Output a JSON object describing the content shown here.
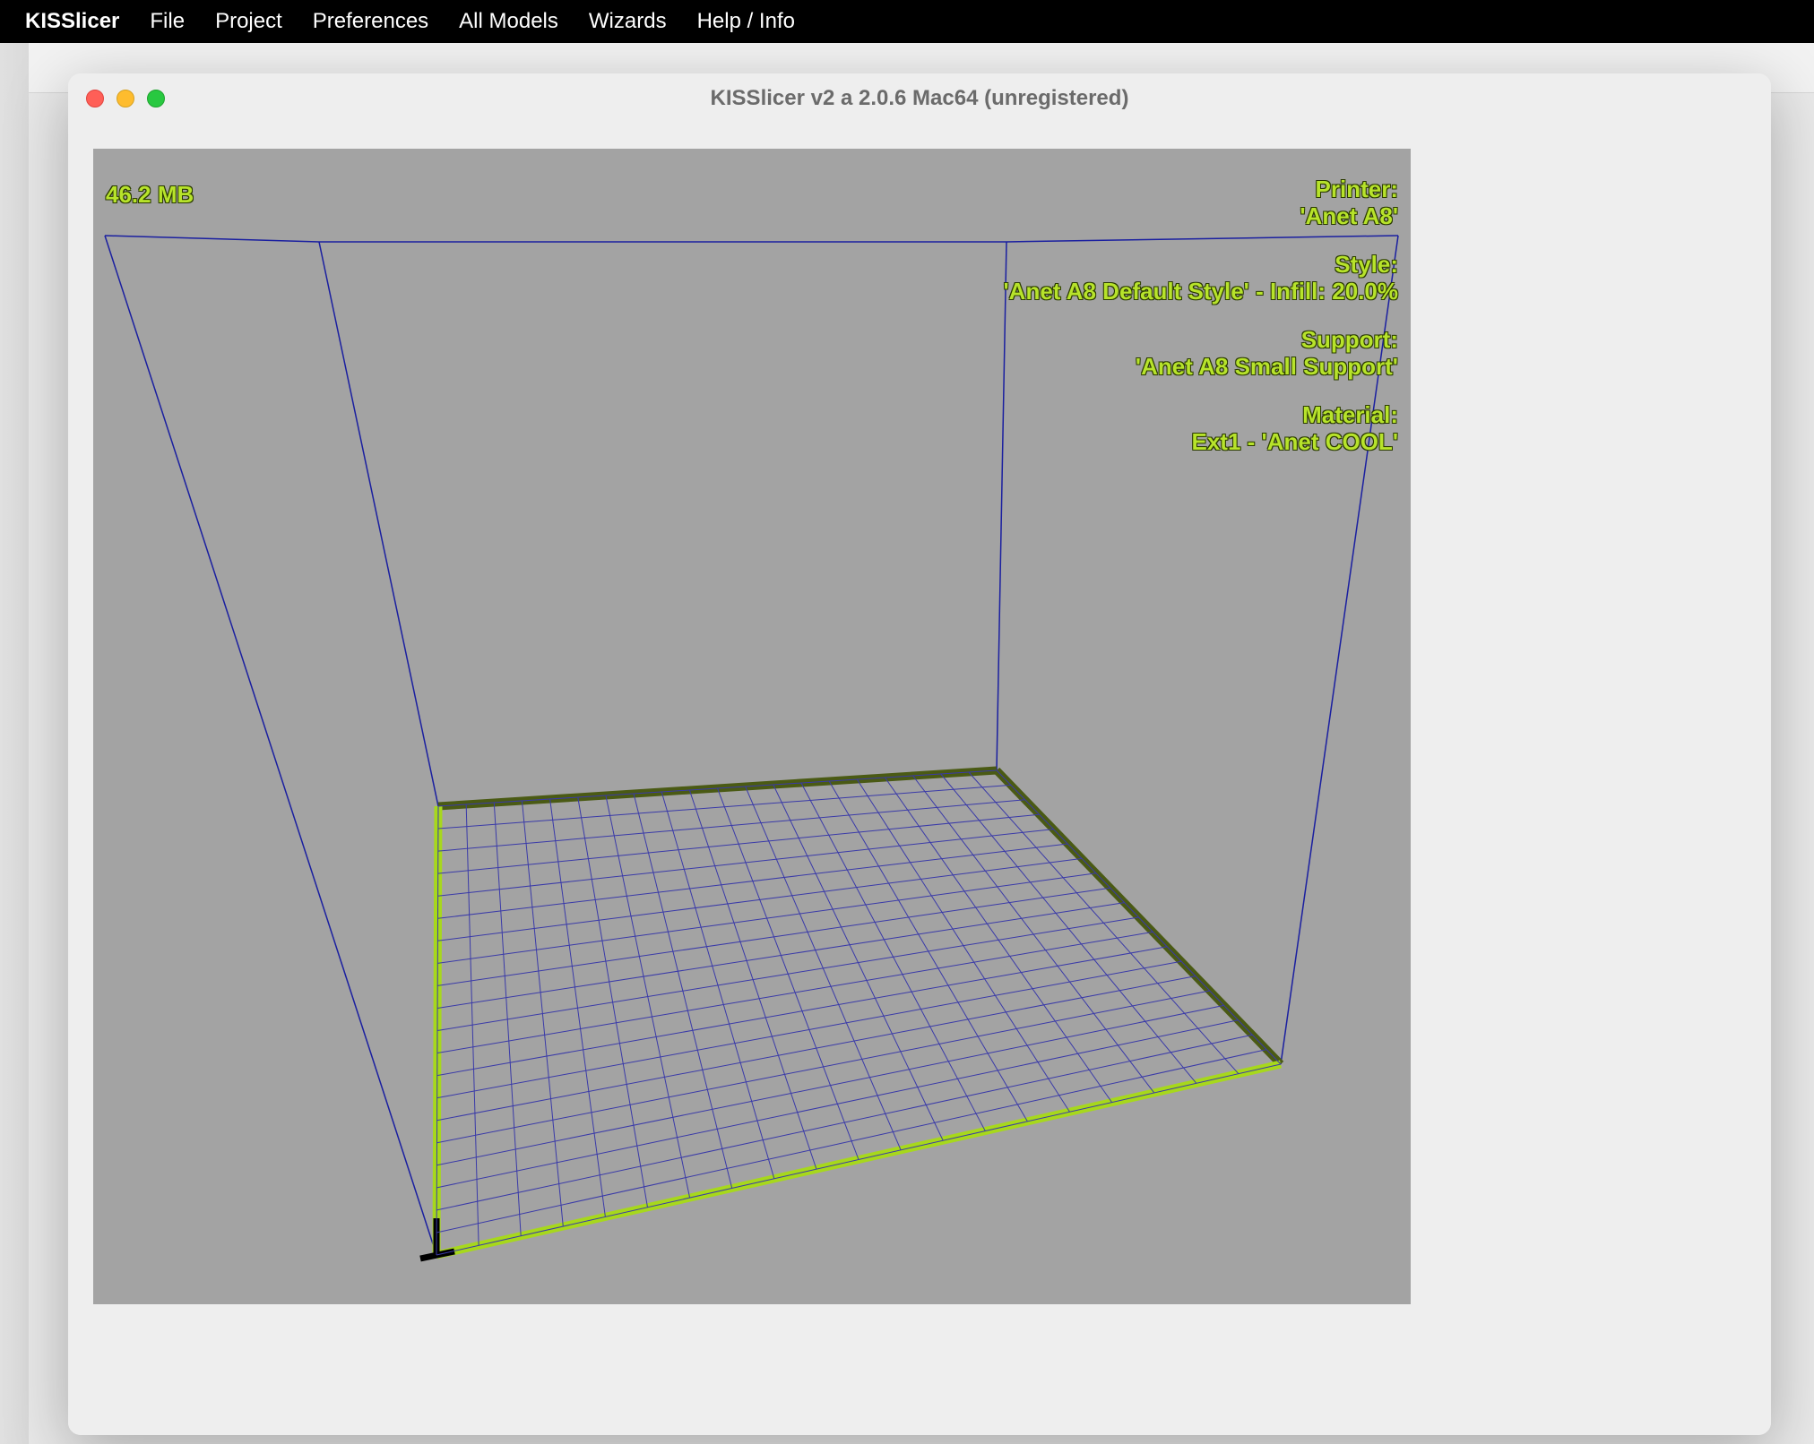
{
  "menubar": {
    "app": "KISSlicer",
    "items": [
      "File",
      "Project",
      "Preferences",
      "All Models",
      "Wizards",
      "Help / Info"
    ]
  },
  "window": {
    "title": "KISSlicer v2 a 2.0.6 Mac64 (unregistered)"
  },
  "viewport": {
    "memory": "46.2 MB",
    "printer_label": "Printer:",
    "printer_value": "'Anet A8'",
    "style_label": "Style:",
    "style_value": "'Anet A8 Default Style' - Infill: 20.0%",
    "support_label": "Support:",
    "support_value": "'Anet A8 Small Support'",
    "material_label": "Material:",
    "material_value": "Ext1 - 'Anet COOL'"
  }
}
